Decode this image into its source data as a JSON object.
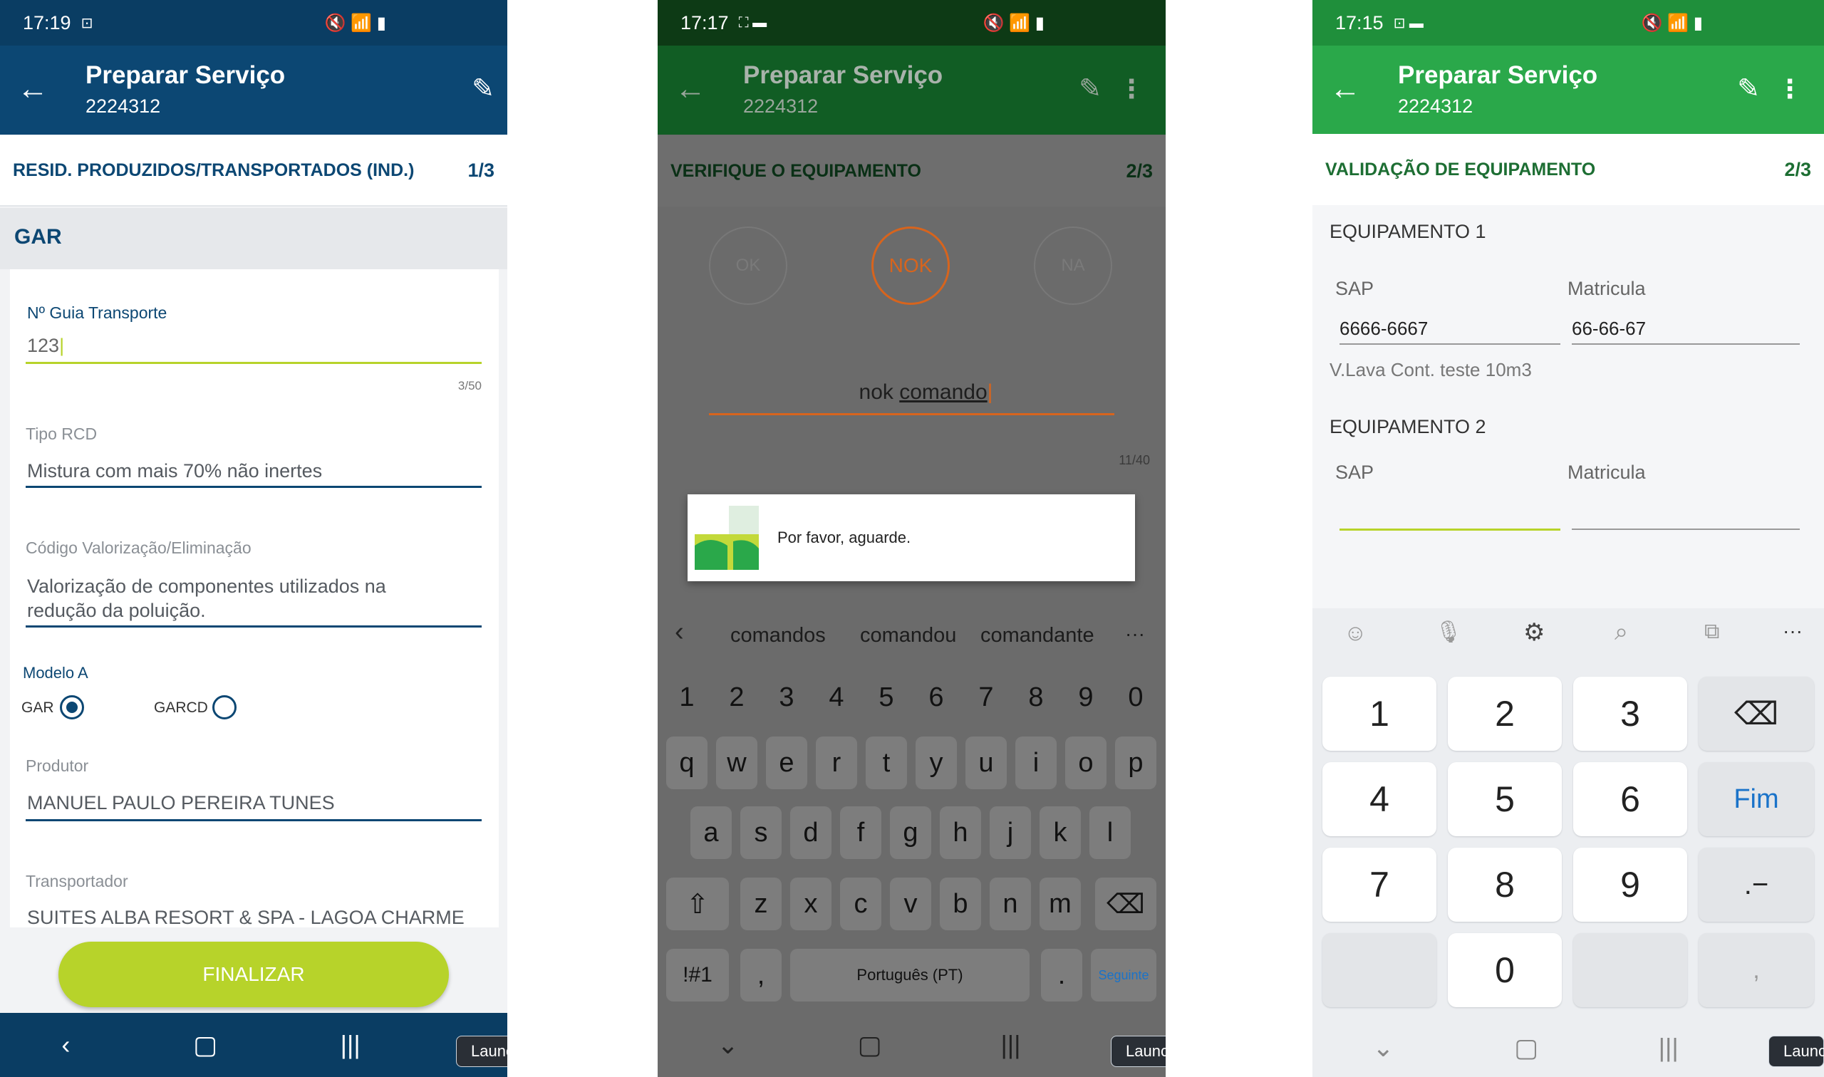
{
  "colors": {
    "navy": "#0c4773",
    "navy_dark": "#0a3d63",
    "green": "#2aa84a",
    "green_dark": "#1f8f3b",
    "green_dim_status": "#0d3a15",
    "green_dim_bar": "#115d24",
    "lime": "#b7d32a",
    "orange": "#d7641d",
    "blue_link": "#1a73c9"
  },
  "phone1": {
    "status": {
      "time": "17:19",
      "extra": "⊡",
      "icons": "🔇 📶 ▮"
    },
    "appbar": {
      "title": "Preparar Serviço",
      "subtitle": "2224312"
    },
    "step": {
      "label": "RESID. PRODUZIDOS/TRANSPORTADOS (IND.)",
      "count": "1/3"
    },
    "section": "GAR",
    "form": {
      "guia_label": "Nº Guia Transporte",
      "guia_value": "123",
      "guia_counter": "3/50",
      "tipo_label": "Tipo RCD",
      "tipo_value": "Mistura com mais 70% não inertes",
      "codigo_label": "Código Valorização/Eliminação",
      "codigo_value_1": "Valorização de componentes utilizados na",
      "codigo_value_2": "redução da poluição.",
      "modelo_label": "Modelo A",
      "radio_gar": "GAR",
      "radio_garcd": "GARCD",
      "produtor_label": "Produtor",
      "produtor_value": "MANUEL PAULO PEREIRA TUNES",
      "transportador_label": "Transportador",
      "transportador_value": "SUITES ALBA RESORT & SPA - LAGOA CHARME"
    },
    "finalizar": "FINALIZAR",
    "nav": {
      "back": "‹",
      "home": "▢",
      "recent": "|||"
    },
    "launch": "Launc"
  },
  "phone2": {
    "status": {
      "time": "17:17",
      "extra": "⛶ ▬",
      "icons": "🔇 📶 ▮"
    },
    "appbar": {
      "title": "Preparar Serviço",
      "subtitle": "2224312"
    },
    "step": {
      "label": "VERIFIQUE O EQUIPAMENTO",
      "count": "2/3"
    },
    "options": [
      "OK",
      "NOK",
      "NA"
    ],
    "input_plain": "nok ",
    "input_underlined": "comando",
    "counter": "11/40",
    "dialog_text": "Por favor, aguarde.",
    "suggestions": [
      "comandos",
      "comandou",
      "comandante"
    ],
    "suggest_more": "···",
    "suggest_back": "‹",
    "number_row": [
      "1",
      "2",
      "3",
      "4",
      "5",
      "6",
      "7",
      "8",
      "9",
      "0"
    ],
    "row1": [
      "q",
      "w",
      "e",
      "r",
      "t",
      "y",
      "u",
      "i",
      "o",
      "p"
    ],
    "row2": [
      "a",
      "s",
      "d",
      "f",
      "g",
      "h",
      "j",
      "k",
      "l"
    ],
    "row3": [
      "z",
      "x",
      "c",
      "v",
      "b",
      "n",
      "m"
    ],
    "shift": "⇧",
    "backspace": "⌫",
    "sym": "!#1",
    "comma": ",",
    "space": "Português (PT)",
    "period": ".",
    "next": "Seguinte",
    "nav": {
      "back": "⌄",
      "home": "▢",
      "recent": "|||"
    },
    "launch": "Launc"
  },
  "phone3": {
    "status": {
      "time": "17:15",
      "extra": "⊡ ▬",
      "icons": "🔇 📶 ▮"
    },
    "appbar": {
      "title": "Preparar Serviço",
      "subtitle": "2224312"
    },
    "step": {
      "label": "VALIDAÇÃO DE EQUIPAMENTO",
      "count": "2/3"
    },
    "equip1": {
      "title": "EQUIPAMENTO 1",
      "sap_label": "SAP",
      "sap_value": "6666-6667",
      "mat_label": "Matricula",
      "mat_value": "66-66-67",
      "desc": "V.Lava Cont. teste 10m3"
    },
    "equip2": {
      "title": "EQUIPAMENTO 2",
      "sap_label": "SAP",
      "sap_value": "",
      "mat_label": "Matricula",
      "mat_value": ""
    },
    "toolbar": [
      "smiley-icon",
      "mic-icon",
      "settings-icon",
      "search-icon",
      "clipboard-icon",
      "more-icon"
    ],
    "toolbar_glyphs": [
      "☺",
      "🎙",
      "⚙",
      "⌕",
      "⧉",
      "···"
    ],
    "keys": [
      "1",
      "2",
      "3",
      "4",
      "5",
      "6",
      "7",
      "8",
      "9",
      "0"
    ],
    "fim": "Fim",
    "dot_minus": ".−",
    "comma": ",",
    "backspace": "⌫",
    "nav": {
      "back": "⌄",
      "home": "▢",
      "recent": "|||"
    },
    "launch": "Launc"
  }
}
